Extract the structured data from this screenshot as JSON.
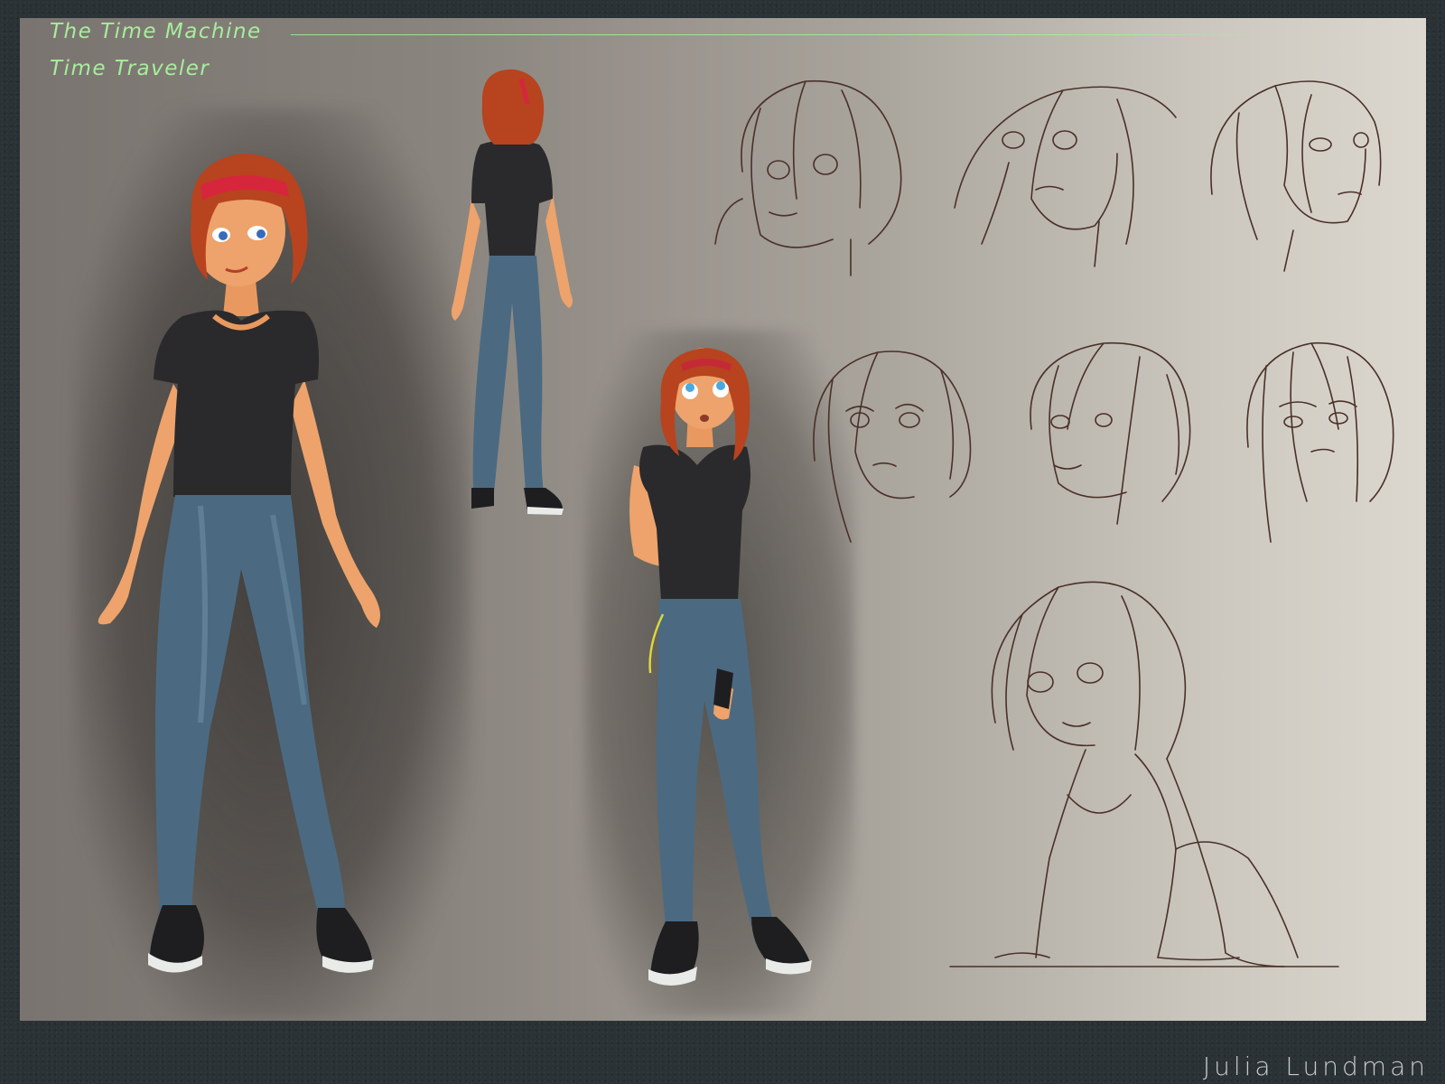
{
  "sheet": {
    "title": "The Time Machine",
    "subtitle": "Time Traveler"
  },
  "artist": {
    "credit": "Julia Lundman"
  },
  "colors": {
    "title_green": "#a6ee9b",
    "hair": "#b8431f",
    "shirt": "#2a2a2c",
    "jeans": "#4b6a82",
    "skin": "#eda36b",
    "sketch_line": "#4a3028",
    "frame": "#2b3236"
  }
}
